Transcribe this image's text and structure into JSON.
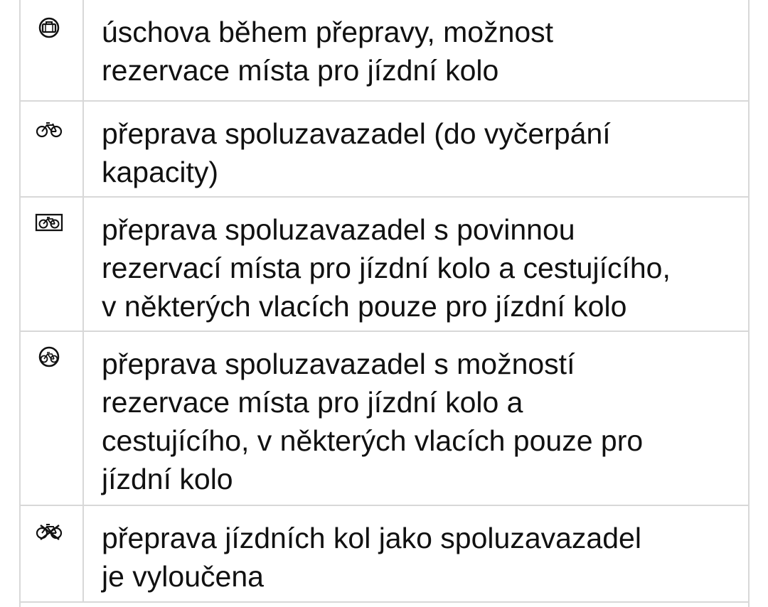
{
  "legend": {
    "rows": [
      {
        "icon": "luggage-storage-icon",
        "lines": [
          "úschova během přepravy, možnost",
          "rezervace místa pro jízdní kolo"
        ]
      },
      {
        "icon": "bicycle-icon",
        "lines": [
          "přeprava spoluzavazadel (do vyčerpání",
          "kapacity)"
        ]
      },
      {
        "icon": "boxed-bicycle-icon",
        "lines": [
          "přeprava spoluzavazadel s povinnou",
          "rezervací místa pro jízdní kolo a cestujícího,",
          "v některých vlacích pouze pro jízdní kolo"
        ]
      },
      {
        "icon": "circled-bicycle-icon",
        "lines": [
          "přeprava spoluzavazadel s možností",
          "rezervace místa pro jízdní kolo a",
          "cestujícího, v některých vlacích pouze pro",
          "jízdní kolo"
        ]
      },
      {
        "icon": "crossed-bicycle-icon",
        "lines": [
          "přeprava jízdních kol jako spoluzavazadel",
          "je vyloučena"
        ]
      }
    ]
  }
}
